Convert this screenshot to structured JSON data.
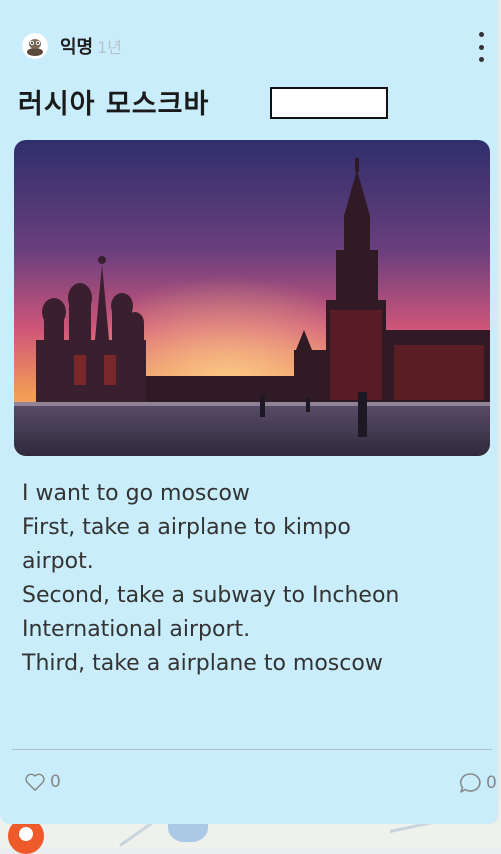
{
  "post": {
    "author": "익명",
    "time": "1년",
    "title": "러시아 모스크바",
    "body_lines": [
      "I want to go moscow",
      "First, take a airplane to kimpo",
      "airpot.",
      "Second, take a subway to Incheon",
      "International airport.",
      "Third, take a airplane to moscow"
    ],
    "likes": "0",
    "comments": "0",
    "image_icon": "photo-image",
    "like_icon": "heart-icon",
    "comment_icon": "comment-icon"
  },
  "colors": {
    "card_background": "#c9edfb",
    "text": "#333333",
    "muted": "#888888"
  }
}
